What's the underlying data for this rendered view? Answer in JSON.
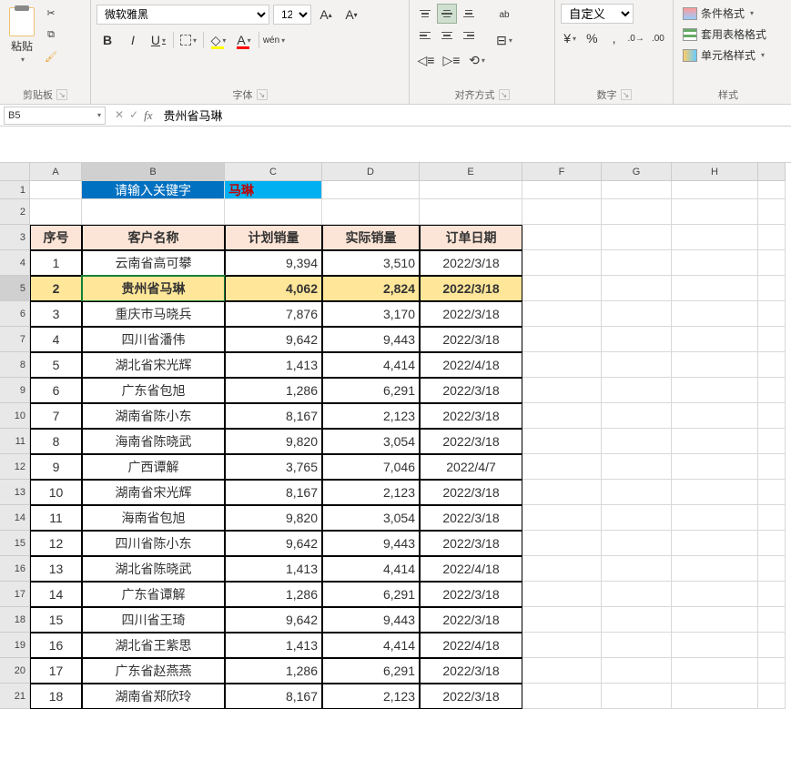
{
  "ribbon": {
    "clipboard": {
      "paste": "粘贴",
      "label": "剪贴板"
    },
    "font": {
      "name": "微软雅黑",
      "size": "12",
      "bold": "B",
      "italic": "I",
      "underline": "U",
      "wen": "wén",
      "label": "字体"
    },
    "align": {
      "wrap": "ab",
      "label": "对齐方式"
    },
    "number": {
      "format": "自定义",
      "percent": "%",
      "comma": ",",
      "label": "数字"
    },
    "styles": {
      "cond": "条件格式",
      "table": "套用表格格式",
      "cell": "单元格样式",
      "label": "样式"
    }
  },
  "namebox": "B5",
  "formula": "贵州省马琳",
  "cols": [
    "A",
    "B",
    "C",
    "D",
    "E",
    "F",
    "G",
    "H",
    ""
  ],
  "search_label": "请输入关键字",
  "search_value": "马琳",
  "headers": [
    "序号",
    "客户名称",
    "计划销量",
    "实际销量",
    "订单日期"
  ],
  "highlight_row": 2,
  "rows": [
    {
      "n": "1",
      "name": "云南省高可攀",
      "p": "9,394",
      "a": "3,510",
      "d": "2022/3/18"
    },
    {
      "n": "2",
      "name": "贵州省马琳",
      "p": "4,062",
      "a": "2,824",
      "d": "2022/3/18"
    },
    {
      "n": "3",
      "name": "重庆市马晓兵",
      "p": "7,876",
      "a": "3,170",
      "d": "2022/3/18"
    },
    {
      "n": "4",
      "name": "四川省潘伟",
      "p": "9,642",
      "a": "9,443",
      "d": "2022/3/18"
    },
    {
      "n": "5",
      "name": "湖北省宋光辉",
      "p": "1,413",
      "a": "4,414",
      "d": "2022/4/18"
    },
    {
      "n": "6",
      "name": "广东省包旭",
      "p": "1,286",
      "a": "6,291",
      "d": "2022/3/18"
    },
    {
      "n": "7",
      "name": "湖南省陈小东",
      "p": "8,167",
      "a": "2,123",
      "d": "2022/3/18"
    },
    {
      "n": "8",
      "name": "海南省陈晓武",
      "p": "9,820",
      "a": "3,054",
      "d": "2022/3/18"
    },
    {
      "n": "9",
      "name": "广西谭解",
      "p": "3,765",
      "a": "7,046",
      "d": "2022/4/7"
    },
    {
      "n": "10",
      "name": "湖南省宋光辉",
      "p": "8,167",
      "a": "2,123",
      "d": "2022/3/18"
    },
    {
      "n": "11",
      "name": "海南省包旭",
      "p": "9,820",
      "a": "3,054",
      "d": "2022/3/18"
    },
    {
      "n": "12",
      "name": "四川省陈小东",
      "p": "9,642",
      "a": "9,443",
      "d": "2022/3/18"
    },
    {
      "n": "13",
      "name": "湖北省陈晓武",
      "p": "1,413",
      "a": "4,414",
      "d": "2022/4/18"
    },
    {
      "n": "14",
      "name": "广东省谭解",
      "p": "1,286",
      "a": "6,291",
      "d": "2022/3/18"
    },
    {
      "n": "15",
      "name": "四川省王琦",
      "p": "9,642",
      "a": "9,443",
      "d": "2022/3/18"
    },
    {
      "n": "16",
      "name": "湖北省王紫思",
      "p": "1,413",
      "a": "4,414",
      "d": "2022/4/18"
    },
    {
      "n": "17",
      "name": "广东省赵燕燕",
      "p": "1,286",
      "a": "6,291",
      "d": "2022/3/18"
    },
    {
      "n": "18",
      "name": "湖南省郑欣玲",
      "p": "8,167",
      "a": "2,123",
      "d": "2022/3/18"
    }
  ]
}
